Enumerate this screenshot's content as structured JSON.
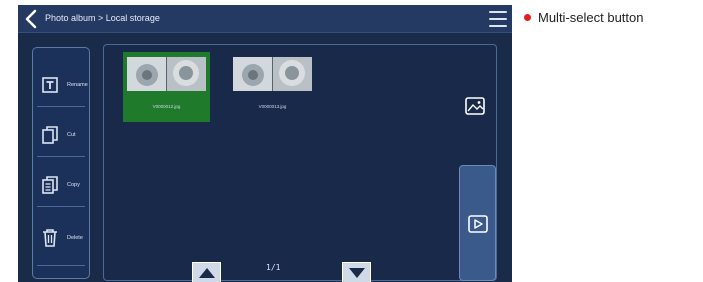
{
  "titlebar": {
    "title": "Photo album > Local storage",
    "back_icon": "chevron-left-icon",
    "menu_icon": "hamburger-menu-icon"
  },
  "sidebar": {
    "items": [
      {
        "label": "Rename",
        "icon": "rename-icon"
      },
      {
        "label": "Cut",
        "icon": "cut-icon"
      },
      {
        "label": "Copy",
        "icon": "copy-icon"
      },
      {
        "label": "Delete",
        "icon": "trash-icon"
      }
    ]
  },
  "thumbnails": [
    {
      "name": "V0000012.jpg",
      "selected": true
    },
    {
      "name": "V0000013.jpg",
      "selected": false
    }
  ],
  "pagination": {
    "page": "1/1"
  },
  "annotation": {
    "text": "Multi-select button",
    "dot_color": "#e02020"
  },
  "colors": {
    "screen_bg": "#1a2b4a",
    "selected_bg": "#1f7a2c",
    "accent": "#3a5a8c"
  }
}
